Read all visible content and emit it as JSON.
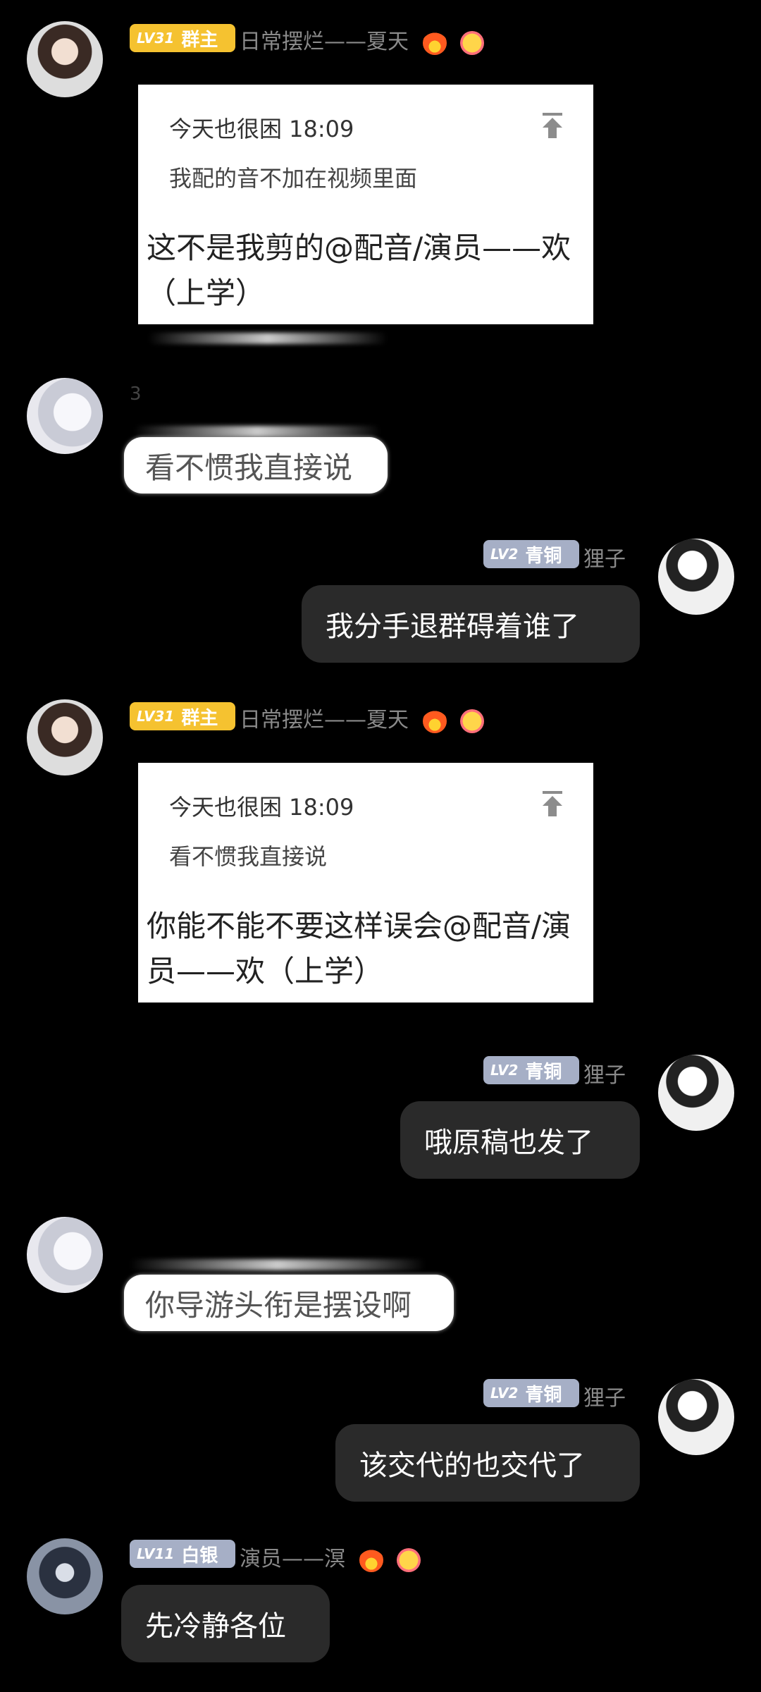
{
  "messages": {
    "m1": {
      "badge_level": "LV31",
      "badge_role": "群主",
      "sender": "日常摆烂——夏天",
      "quote_author": "今天也很困 18:09",
      "quote_text": "我配的音不加在视频里面",
      "text": "这不是我剪的@配音/演员——欢（上学）"
    },
    "m2": {
      "small_label": "3",
      "text": "看不惯我直接说"
    },
    "m3": {
      "badge_level": "LV2",
      "badge_role": "青铜",
      "sender": "狸子",
      "text": "我分手退群碍着谁了"
    },
    "m4": {
      "badge_level": "LV31",
      "badge_role": "群主",
      "sender": "日常摆烂——夏天",
      "quote_author": "今天也很困 18:09",
      "quote_text": "看不惯我直接说",
      "text": "你能不能不要这样误会@配音/演员——欢（上学）"
    },
    "m5": {
      "badge_level": "LV2",
      "badge_role": "青铜",
      "sender": "狸子",
      "text": "哦原稿也发了"
    },
    "m6": {
      "text": "你导游头衔是摆设啊"
    },
    "m7": {
      "badge_level": "LV2",
      "badge_role": "青铜",
      "sender": "狸子",
      "text": "该交代的也交代了"
    },
    "m8": {
      "badge_level": "LV11",
      "badge_role": "白银",
      "sender": "演员——溟",
      "text": "先冷静各位"
    }
  },
  "colors": {
    "background": "#000000",
    "badge_gold": "#f5c230",
    "badge_blue": "#a6afc6",
    "bubble_dark": "#2a2a2a",
    "name_gray": "#8a8a8a"
  },
  "icons": {
    "pin": "pin-to-top-icon",
    "fire": "fire-emoji-icon",
    "face": "flower-face-emoji-icon"
  }
}
